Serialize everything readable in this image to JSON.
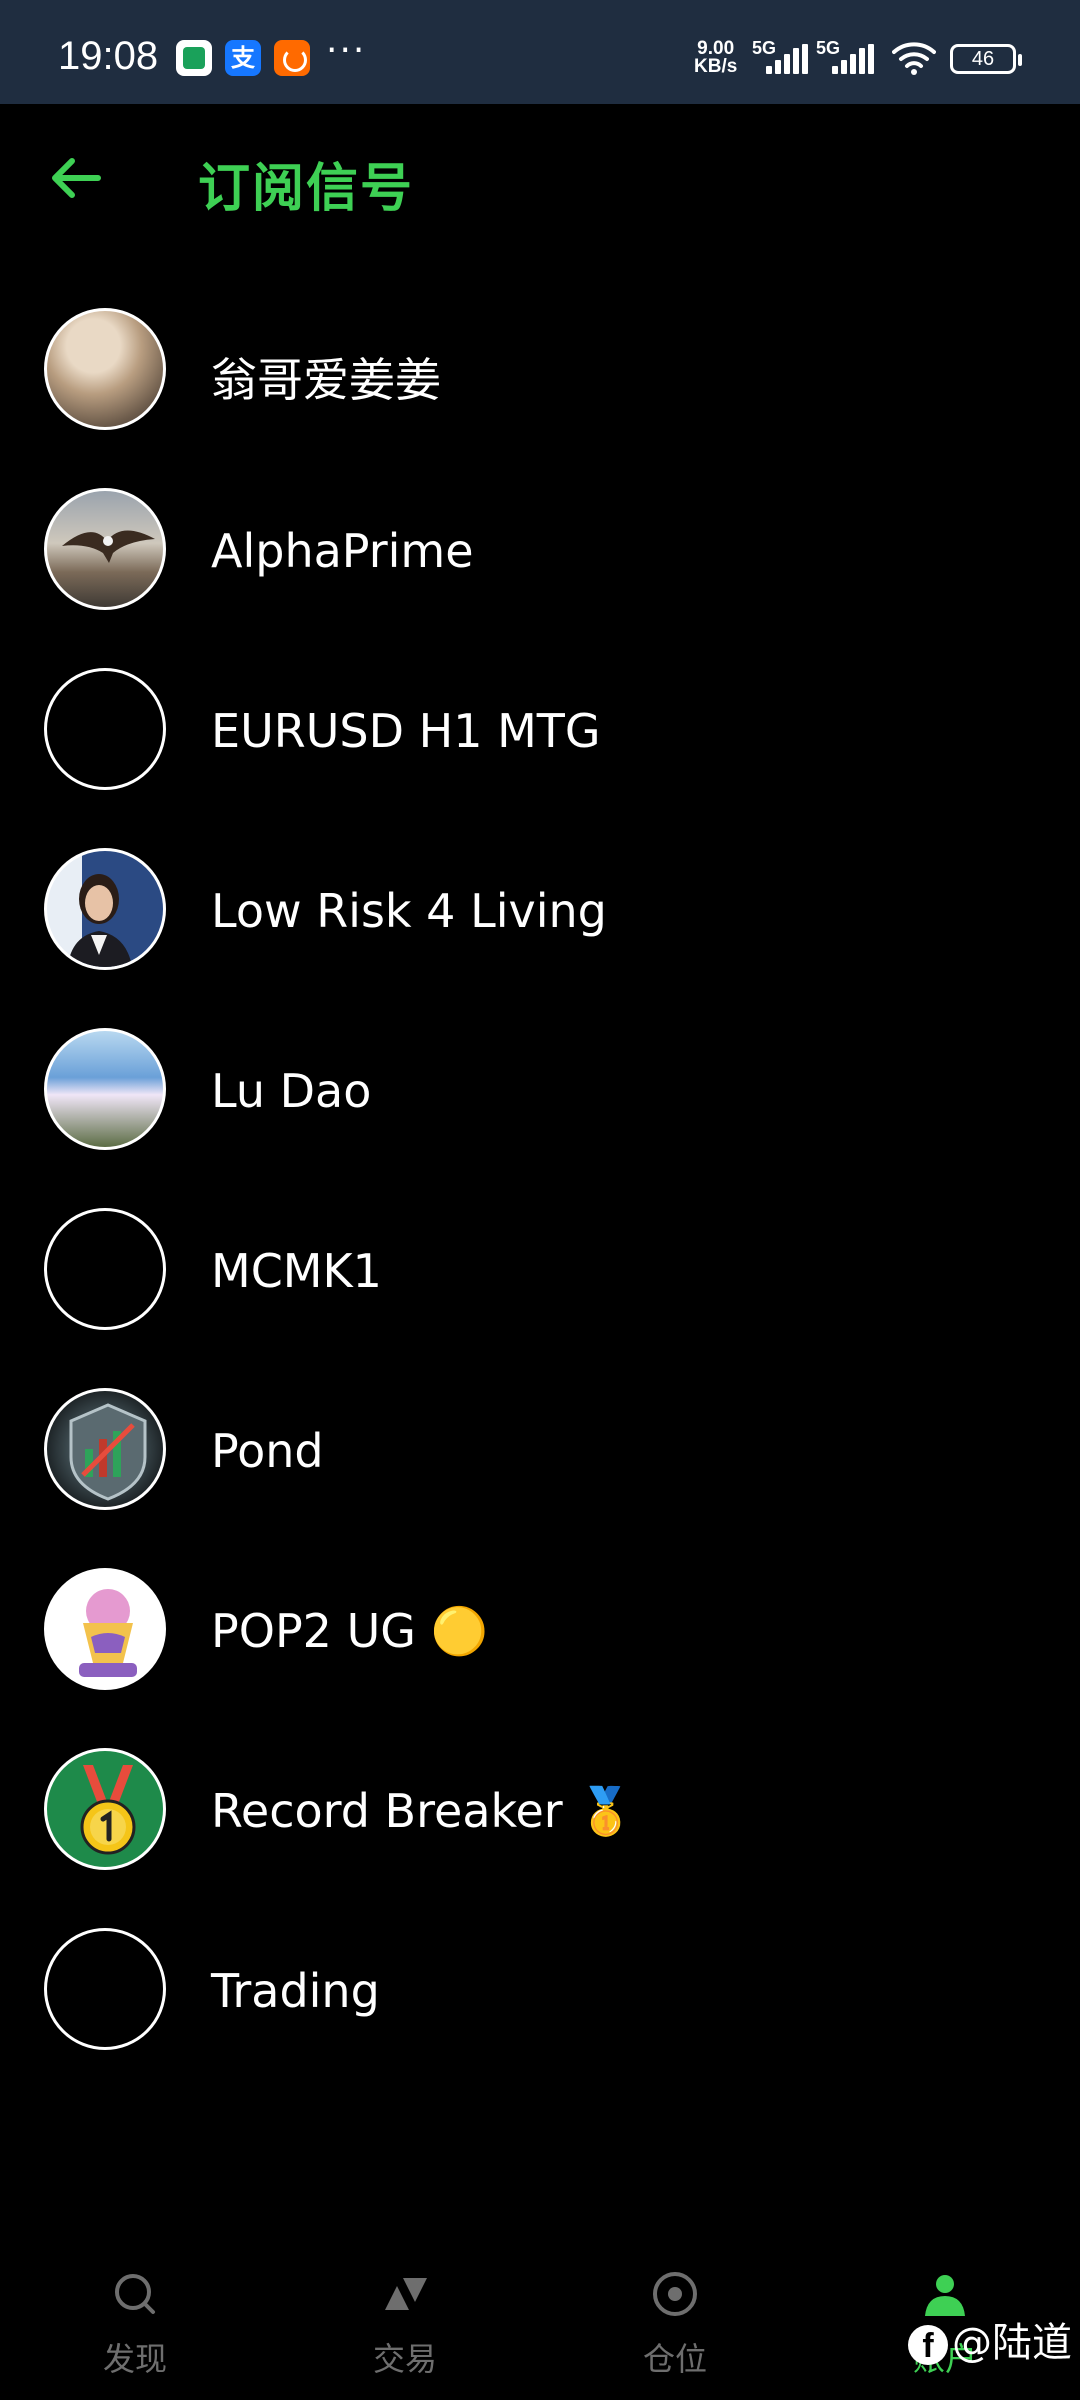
{
  "status_bar": {
    "time": "19:08",
    "alipay_glyph": "支",
    "more": "···",
    "net_speed_value": "9.00",
    "net_speed_unit": "KB/s",
    "sim1_label": "5G",
    "sim2_label": "5G",
    "battery": "46"
  },
  "header": {
    "title": "订阅信号",
    "back_icon": "arrow-left-icon"
  },
  "signals": [
    {
      "name": "翁哥爱姜姜",
      "has_avatar": true
    },
    {
      "name": "AlphaPrime",
      "has_avatar": true
    },
    {
      "name": "EURUSD H1 MTG",
      "has_avatar": false
    },
    {
      "name": "Low Risk 4 Living",
      "has_avatar": true
    },
    {
      "name": "Lu Dao",
      "has_avatar": true
    },
    {
      "name": "MCMK1",
      "has_avatar": false
    },
    {
      "name": "Pond",
      "has_avatar": true
    },
    {
      "name": "POP2 UG 🟡",
      "has_avatar": true
    },
    {
      "name": "Record Breaker 🥇",
      "has_avatar": true
    },
    {
      "name": "Trading",
      "has_avatar": false
    }
  ],
  "nav": {
    "items": [
      {
        "label": "发现",
        "icon": "search-icon",
        "active": false
      },
      {
        "label": "交易",
        "icon": "trade-arrows-icon",
        "active": false
      },
      {
        "label": "仓位",
        "icon": "position-target-icon",
        "active": false
      },
      {
        "label": "账户",
        "icon": "account-person-icon",
        "active": true
      }
    ]
  },
  "watermark": {
    "logo_letter": "f",
    "text": "@陆道"
  },
  "colors": {
    "accent": "#3ed054",
    "status_bar_bg": "#1f2d40",
    "background": "#000000",
    "nav_inactive": "#6e6e6e"
  }
}
